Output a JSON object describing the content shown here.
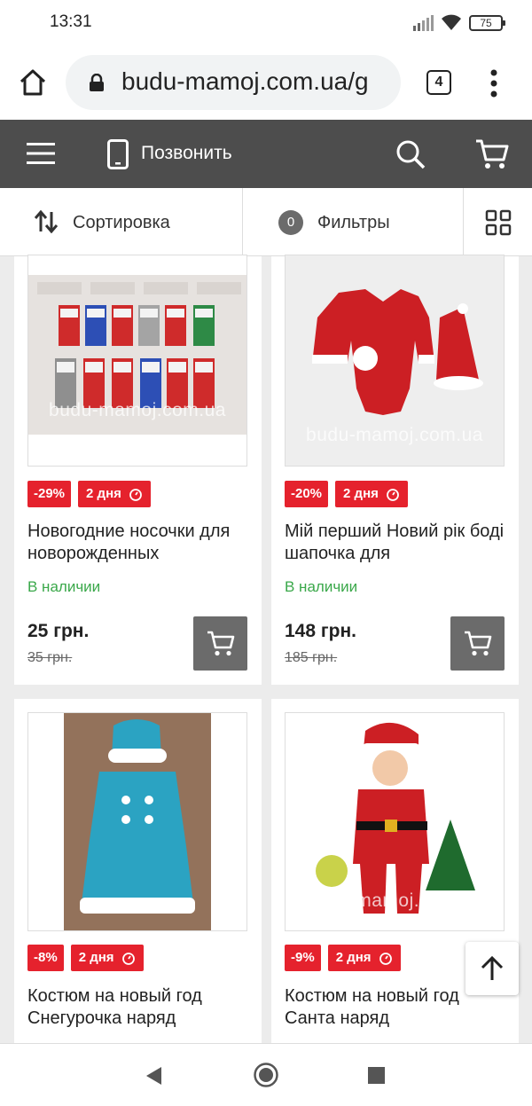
{
  "status_bar": {
    "time": "13:31",
    "battery": "75"
  },
  "browser": {
    "url": "budu-mamoj.com.ua/g",
    "tab_count": "4"
  },
  "header": {
    "call_label": "Позвонить"
  },
  "toolbar": {
    "sort_label": "Сортировка",
    "filter_count": "0",
    "filter_label": "Фильтры"
  },
  "watermark": "budu-mamoj.com.ua",
  "products": [
    {
      "name": "Новогодние носочки для новорожденных",
      "discount": "-29%",
      "timer": "2 дня",
      "stock": "В наличии",
      "price": "25 грн.",
      "old_price": "35 грн."
    },
    {
      "name": "Мій перший Новий рік боді шапочка для",
      "discount": "-20%",
      "timer": "2 дня",
      "stock": "В наличии",
      "price": "148 грн.",
      "old_price": "185 грн."
    },
    {
      "name": "Костюм на новый год Снегурочка наряд",
      "discount": "-8%",
      "timer": "2 дня"
    },
    {
      "name": "Костюм на новый год Санта наряд",
      "discount": "-9%",
      "timer": "2 дня"
    }
  ]
}
